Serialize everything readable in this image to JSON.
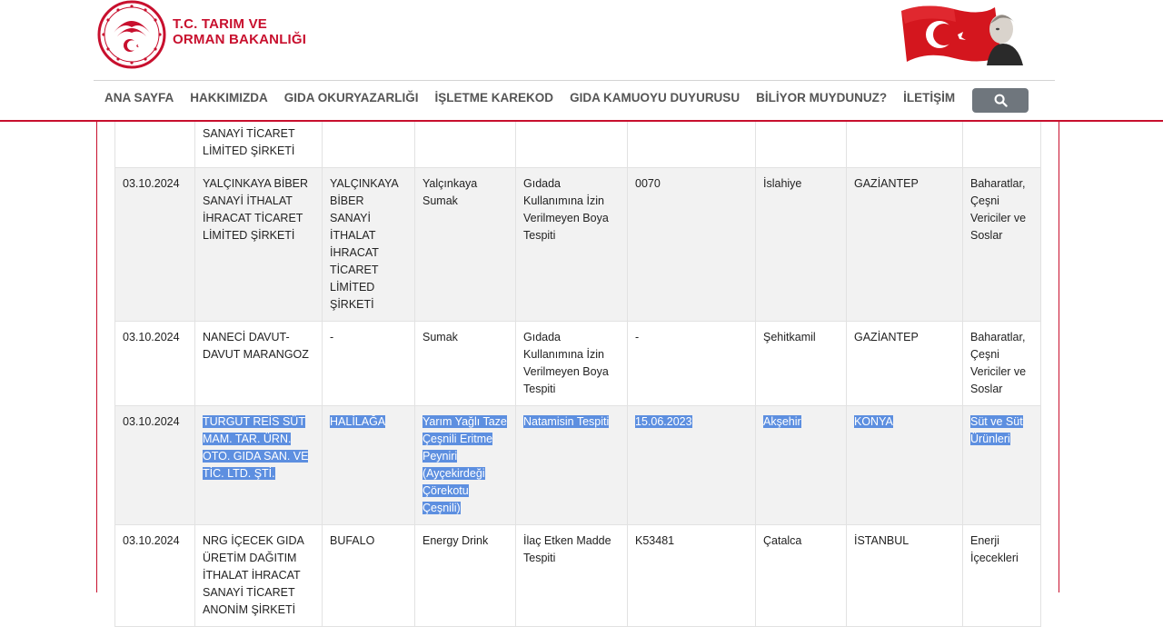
{
  "header": {
    "brand_line1": "T.C. TARIM VE",
    "brand_line2": "ORMAN BAKANLIĞI"
  },
  "nav": {
    "items": [
      "ANA SAYFA",
      "HAKKIMIZDA",
      "GIDA OKURYAZARLIĞI",
      "İŞLETME KAREKOD",
      "GIDA KAMUOYU DUYURUSU",
      "BİLİYOR MUYDUNUZ?",
      "İLETİŞİM"
    ],
    "search_icon": "search-icon"
  },
  "table": {
    "rows": [
      {
        "date": "",
        "company": "SANAYİ TİCARET LİMİTED ŞİRKETİ",
        "brand": "",
        "product": "",
        "issue": "",
        "batch": "",
        "district": "",
        "province": "",
        "group": ""
      },
      {
        "date": "03.10.2024",
        "company": "YALÇINKAYA BİBER SANAYİ İTHALAT İHRACAT TİCARET LİMİTED ŞİRKETİ",
        "brand": "YALÇINKAYA BİBER SANAYİ İTHALAT İHRACAT TİCARET LİMİTED ŞİRKETİ",
        "product": "Yalçınkaya Sumak",
        "issue": "Gıdada Kullanımına İzin Verilmeyen Boya Tespiti",
        "batch": "0070",
        "district": "İslahiye",
        "province": "GAZİANTEP",
        "group": "Baharatlar, Çeşni Vericiler ve Soslar"
      },
      {
        "date": "03.10.2024",
        "company": "NANECİ DAVUT-DAVUT MARANGOZ",
        "brand": "-",
        "product": "Sumak",
        "issue": "Gıdada Kullanımına İzin Verilmeyen Boya Tespiti",
        "batch": "-",
        "district": "Şehitkamil",
        "province": "GAZİANTEP",
        "group": "Baharatlar, Çeşni Vericiler ve Soslar"
      },
      {
        "date": "03.10.2024",
        "company": "TURGUT REİS SÜT MAM. TAR. ÜRN. OTO. GIDA SAN. VE TİC. LTD. ŞTİ.",
        "brand": "HALİLAĞA",
        "product": "Yarım Yağlı Taze Çeşnili Eritme Peyniri (Ayçekirdeği Çörekotu Çeşnili)",
        "issue": "Natamisin Tespiti",
        "batch": "15.06.2023",
        "district": "Akşehir",
        "province": "KONYA",
        "group": "Süt ve Süt Ürünleri"
      },
      {
        "date": "03.10.2024",
        "company": "NRG İÇECEK GIDA ÜRETİM DAĞITIM İTHALAT İHRACAT SANAYİ TİCARET ANONİM ŞİRKETİ",
        "brand": "BUFALO",
        "product": "Energy Drink",
        "issue": "İlaç Etken Madde Tespiti",
        "batch": "K53481",
        "district": "Çatalca",
        "province": "İSTANBUL",
        "group": "Enerji İçecekleri"
      }
    ]
  },
  "colors": {
    "brand_red": "#c8102e",
    "selection": "#5d8fe0",
    "row_alt": "#f2f2f2"
  }
}
